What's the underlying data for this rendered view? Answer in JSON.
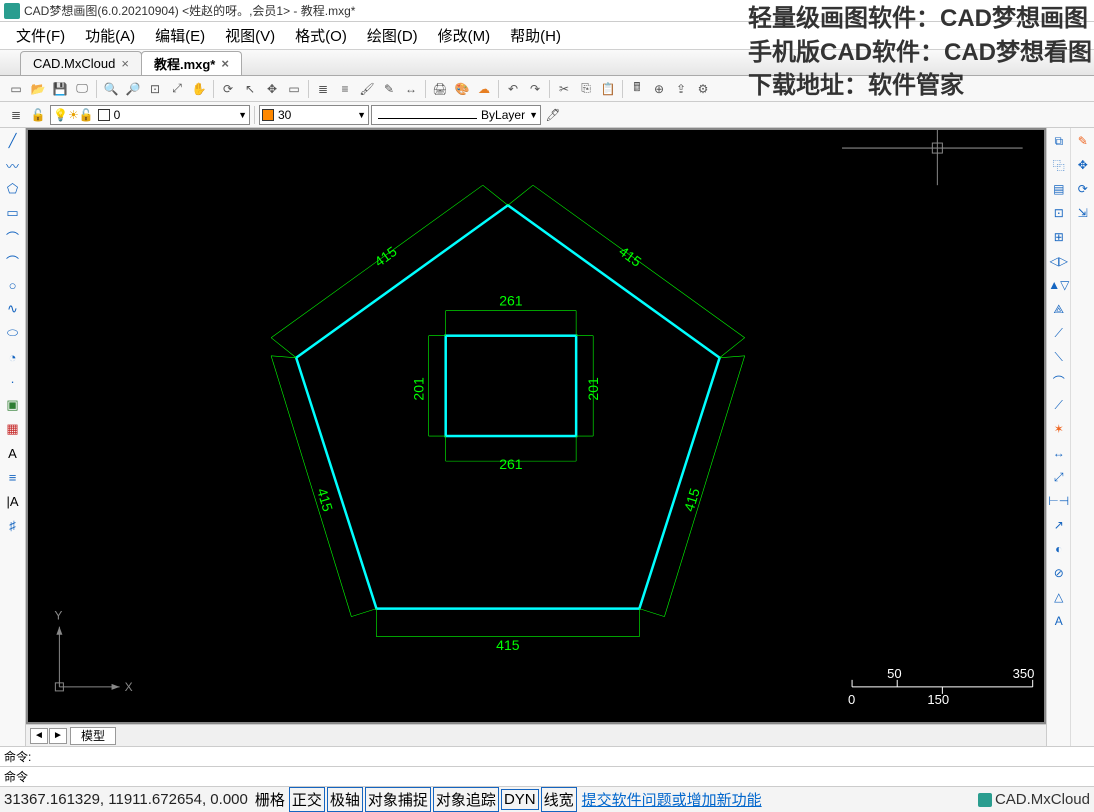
{
  "title": "CAD梦想画图(6.0.20210904) <姓赵的呀。,会员1> - 教程.mxg*",
  "menu": [
    "文件(F)",
    "功能(A)",
    "编辑(E)",
    "视图(V)",
    "格式(O)",
    "绘图(D)",
    "修改(M)",
    "帮助(H)"
  ],
  "tabs": [
    {
      "label": "CAD.MxCloud",
      "active": false
    },
    {
      "label": "教程.mxg*",
      "active": true
    }
  ],
  "layer_dd": "0",
  "color_dd": "30",
  "linetype_dd": "ByLayer",
  "model_tab": "模型",
  "cmd_label": "命令:",
  "cmd2_label": "命令",
  "status": {
    "coord": "31367.161329,  11911.672654,  0.000",
    "buttons": [
      "栅格",
      "正交",
      "极轴",
      "对象捕捉",
      "对象追踪",
      "DYN",
      "线宽"
    ],
    "link": "提交软件问题或增加新功能",
    "brand": "CAD.MxCloud"
  },
  "overlay": {
    "l1": "轻量级画图软件：CAD梦想画图",
    "l2": "手机版CAD软件：CAD梦想看图",
    "l3": "下载地址：软件管家"
  },
  "dims": {
    "p_side": "415",
    "p_bottom": "415",
    "r_w": "261",
    "r_h": "201"
  },
  "scale": {
    "s1": "0",
    "s2": "50",
    "s3": "150",
    "s4": "350"
  },
  "axis": {
    "x": "X",
    "y": "Y"
  }
}
